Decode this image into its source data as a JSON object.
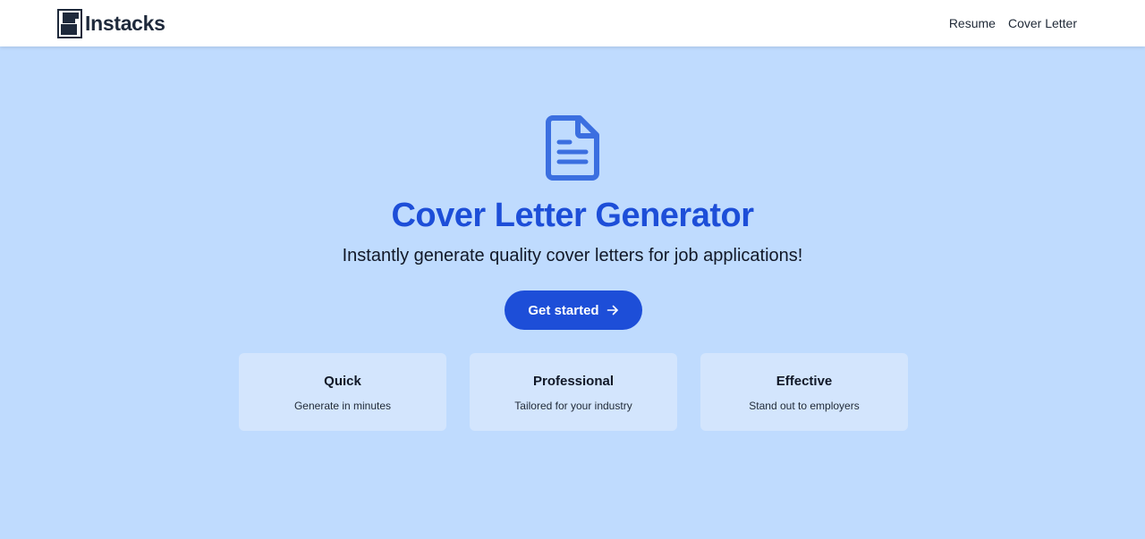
{
  "nav": {
    "brand_name": "Instacks",
    "links": [
      {
        "label": "Resume"
      },
      {
        "label": "Cover Letter"
      }
    ]
  },
  "hero": {
    "icon": "document-icon",
    "title": "Cover Letter Generator",
    "subtitle": "Instantly generate quality cover letters for job applications!",
    "cta_label": "Get started",
    "cta_icon": "arrow-right-icon"
  },
  "features": [
    {
      "title": "Quick",
      "description": "Generate in minutes"
    },
    {
      "title": "Professional",
      "description": "Tailored for your industry"
    },
    {
      "title": "Effective",
      "description": "Stand out to employers"
    }
  ],
  "colors": {
    "background": "#bfdbfe",
    "accent": "#1d4ed8",
    "icon": "#3b6fe0",
    "card": "#d3e5fd",
    "navbar": "#ffffff"
  }
}
